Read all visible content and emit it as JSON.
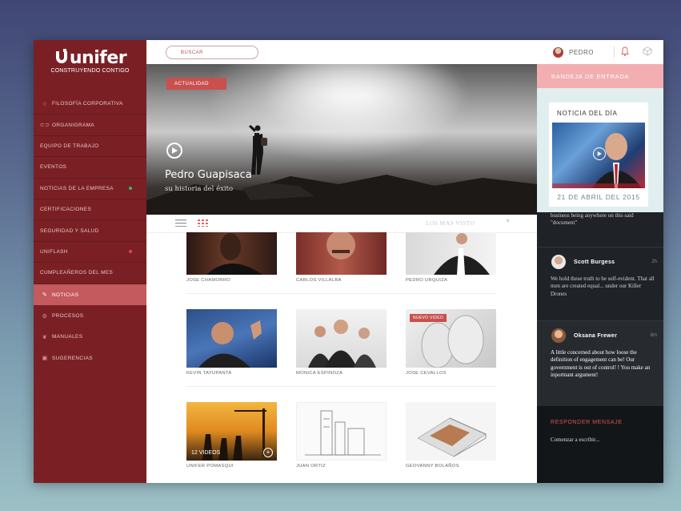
{
  "brand": {
    "name": "unifer",
    "tagline": "CONSTRUYENDO CONTIGO"
  },
  "search": {
    "placeholder": "BUSCAR"
  },
  "sidebar": {
    "items": [
      {
        "label": "FILOSOFÍA CORPORATIVA",
        "icon": "star-icon"
      },
      {
        "label": "ORGANIGRAMA",
        "icon": "org-chart-icon"
      },
      {
        "label": "EQUIPO DE TRABAJO",
        "icon": ""
      },
      {
        "label": "EVENTOS",
        "icon": ""
      },
      {
        "label": "NOTICIAS DE LA EMPRESA",
        "icon": "",
        "dot": "#3cb371"
      },
      {
        "label": "CERTIFICACIONES",
        "icon": ""
      },
      {
        "label": "SEGURIDAD Y SALUD",
        "icon": ""
      },
      {
        "label": "UNIFLASH",
        "icon": "",
        "dot": "#e0464e"
      },
      {
        "label": "CUMPLEAÑEROS DEL MES",
        "icon": ""
      }
    ],
    "lower_items": [
      {
        "label": "NOTICIAS",
        "icon": "pencil-icon",
        "active": true
      },
      {
        "label": "PROCESOS",
        "icon": "gear-icon"
      },
      {
        "label": "MANUALES",
        "icon": "book-icon"
      },
      {
        "label": "SUGERENCIAS",
        "icon": "chat-icon"
      }
    ]
  },
  "hero": {
    "badge": "ACTUALIDAD",
    "title": "Pedro Guapisaca",
    "subtitle": "su historia del éxito"
  },
  "toolbar": {
    "sort_label": "LOS MAS VISTO"
  },
  "grid": {
    "items": [
      {
        "caption": "JOSE CHAMORRO"
      },
      {
        "caption": "CARLOS VILLALBA"
      },
      {
        "caption": "PEDRO URQUIZA"
      },
      {
        "caption": "KEVIN TAYUPANTA"
      },
      {
        "caption": "MONICA ESPINOZA"
      },
      {
        "caption": "JOSE CEVALLOS",
        "badge": "NUEVO VIDEO"
      },
      {
        "caption": "UNIFER POMASQUI",
        "count": "12 VIDEOS"
      },
      {
        "caption": "JUAN ORTIZ"
      },
      {
        "caption": "GEOVANNY BOLAÑOS"
      }
    ]
  },
  "user": {
    "name": "PEDRO"
  },
  "inbox": {
    "label": "BANDEJA DE ENTRADA"
  },
  "news": {
    "label": "NOTICIA DEL DÍA",
    "date": "21 DE ABRIL DEL 2015"
  },
  "messages": {
    "snippet": "business being anywhere on this said \"document\"",
    "items": [
      {
        "name": "Scott Burgess",
        "time": "2h",
        "body": "We hold these truth to be self-evident. That all men are created equal... under our Killer Drones"
      },
      {
        "name": "Oksana Frewer",
        "time": "8m",
        "body": "A little concerned about how loose the definition of engagement can be! Our government is out of control! ! You make an inportnant argument!"
      }
    ]
  },
  "reply": {
    "label": "RESPONDER MENSAJE",
    "placeholder": "Comenzar a escribir..."
  },
  "colors": {
    "sidebar": "#7a2025",
    "accent": "#c9504f",
    "inbox": "#f2aeb0",
    "panel": "#1f2327"
  }
}
